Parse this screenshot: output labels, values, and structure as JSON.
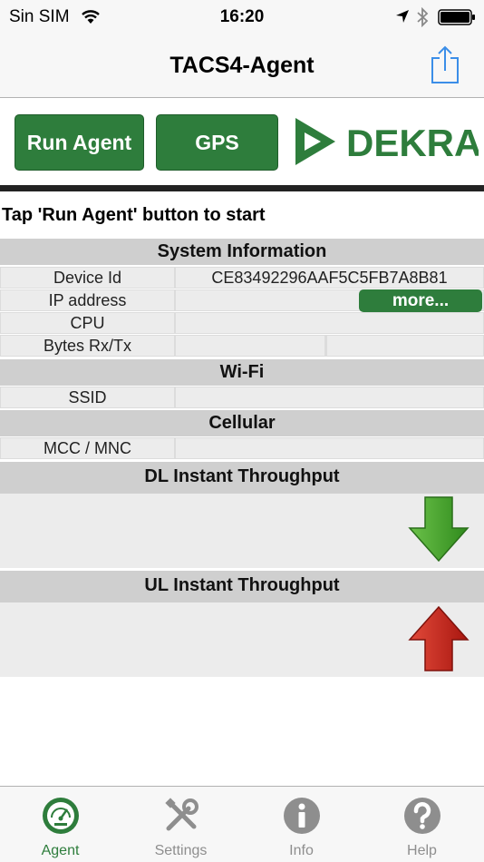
{
  "status_bar": {
    "carrier": "Sin SIM",
    "time": "16:20"
  },
  "nav": {
    "title": "TACS4-Agent"
  },
  "actions": {
    "run_agent_label": "Run Agent",
    "gps_label": "GPS",
    "logo_text": "DEKRA"
  },
  "instruction": "Tap 'Run Agent' button to start",
  "system_info": {
    "header": "System Information",
    "device_id_label": "Device Id",
    "device_id_value": "CE83492296AAF5C5FB7A8B81",
    "ip_label": "IP address",
    "more_label": "more...",
    "cpu_label": "CPU",
    "bytes_label": "Bytes Rx/Tx"
  },
  "wifi": {
    "header": "Wi-Fi",
    "ssid_label": "SSID"
  },
  "cellular": {
    "header": "Cellular",
    "mcc_label": "MCC / MNC"
  },
  "dl": {
    "header": "DL Instant Throughput"
  },
  "ul": {
    "header": "UL Instant Throughput"
  },
  "tabs": [
    {
      "label": "Agent",
      "icon": "gauge-icon",
      "active": true
    },
    {
      "label": "Settings",
      "icon": "tools-icon",
      "active": false
    },
    {
      "label": "Info",
      "icon": "info-icon",
      "active": false
    },
    {
      "label": "Help",
      "icon": "help-icon",
      "active": false
    }
  ],
  "colors": {
    "accent": "#2e7d3c",
    "dl_arrow": "#3a9a2a",
    "ul_arrow": "#c8201a",
    "ios_blue": "#3b8ee8"
  }
}
